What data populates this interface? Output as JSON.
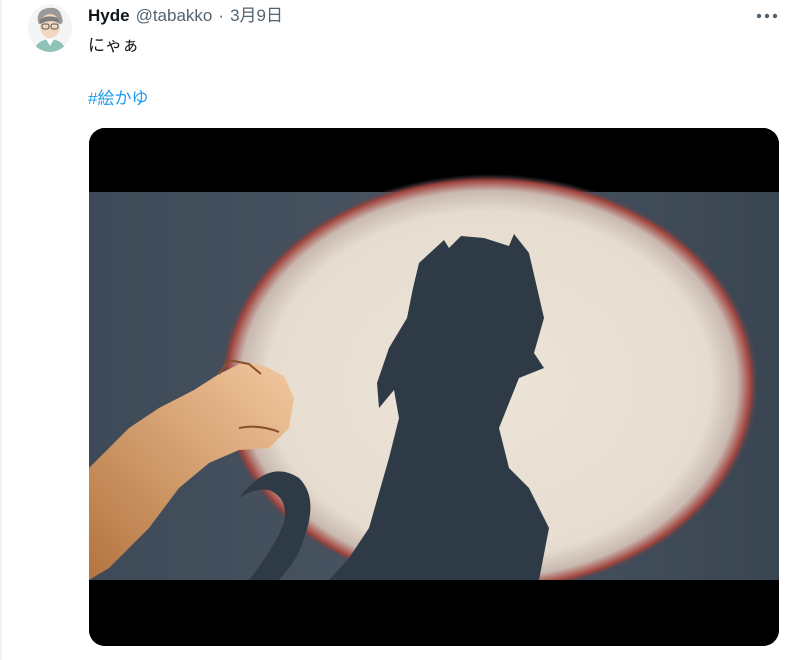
{
  "tweet": {
    "display_name": "Hyde",
    "handle": "@tabakko",
    "separator": "·",
    "date": "3月9日",
    "text": "にゃぁ",
    "hashtag": "#絵かゆ",
    "more_icon": "more-horizontal-icon"
  },
  "media": {
    "description_icon": "shadow-cat-girl-artwork"
  },
  "colors": {
    "link": "#1d9bf0",
    "secondary_text": "#536471",
    "text": "#0f1419"
  }
}
